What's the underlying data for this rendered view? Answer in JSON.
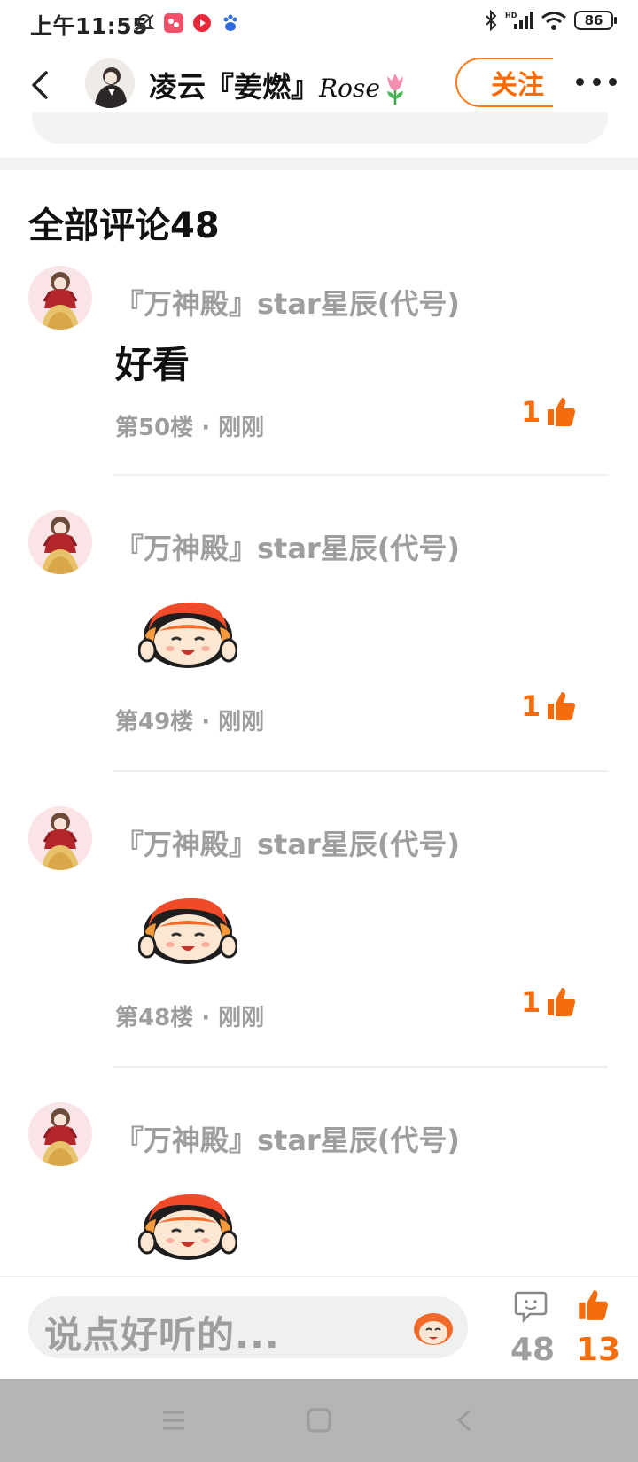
{
  "status_bar": {
    "time": "上午11:55",
    "battery": "86"
  },
  "header": {
    "author_name": "凌云『姜燃』",
    "author_suffix": "Rose",
    "follow_label": "关注"
  },
  "comments_section": {
    "title": "全部评论48",
    "comments": [
      {
        "user": "『万神殿』star星辰(代号)",
        "text": "好看",
        "meta": "第50楼 · 刚刚",
        "likes": "1"
      },
      {
        "user": "『万神殿』star星辰(代号)",
        "sticker": "cartoon-sticker",
        "meta": "第49楼 · 刚刚",
        "likes": "1"
      },
      {
        "user": "『万神殿』star星辰(代号)",
        "sticker": "cartoon-sticker",
        "meta": "第48楼 · 刚刚",
        "likes": "1"
      },
      {
        "user": "『万神殿』star星辰(代号)",
        "sticker": "cartoon-sticker"
      }
    ]
  },
  "bottom_bar": {
    "input_placeholder": "说点好听的...",
    "comment_count": "48",
    "like_count": "13"
  },
  "colors": {
    "accent": "#f36d0f",
    "muted": "#9e9e9e"
  }
}
